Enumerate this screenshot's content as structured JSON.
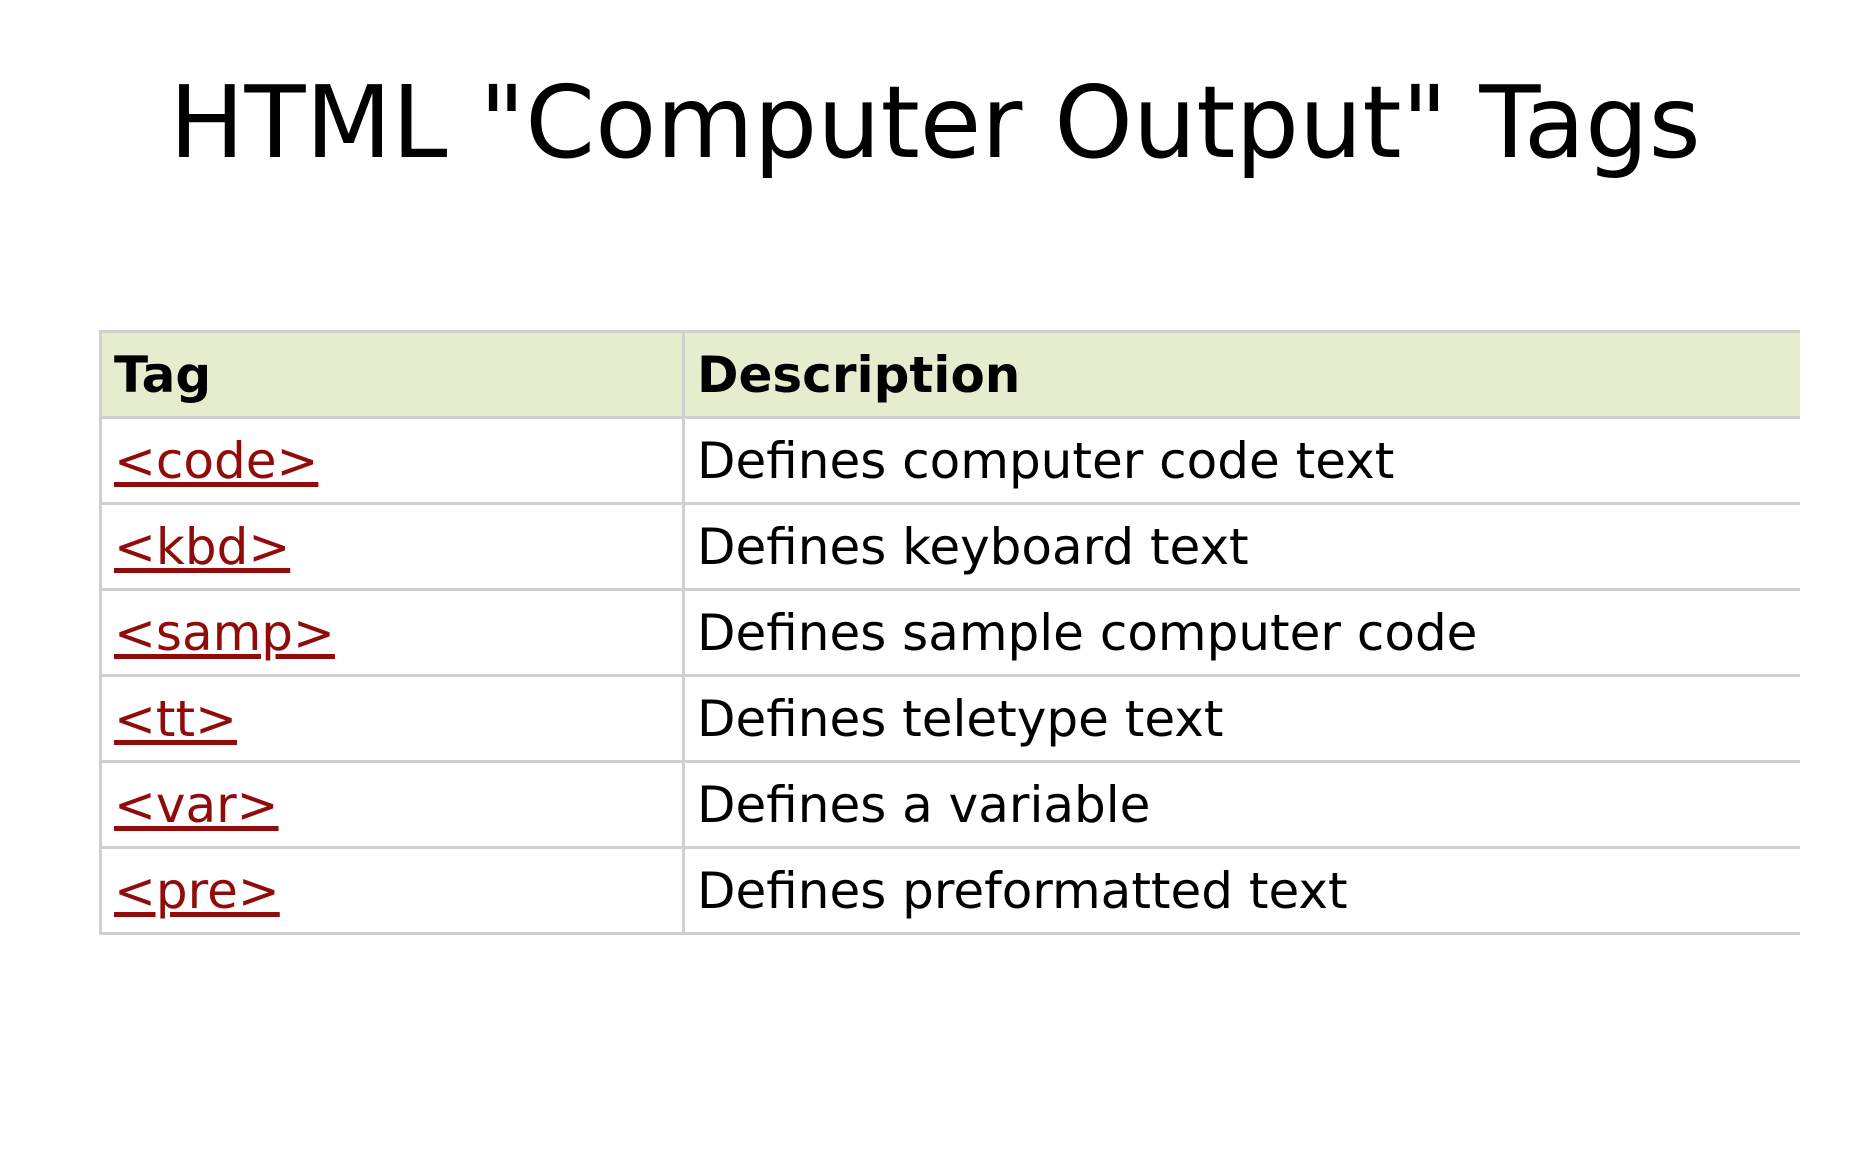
{
  "slide": {
    "title": "HTML \"Computer Output\" Tags"
  },
  "table": {
    "headers": {
      "tag": "Tag",
      "description": "Description"
    },
    "rows": [
      {
        "tag": "<code>",
        "description": "Defines computer code text"
      },
      {
        "tag": "<kbd>",
        "description": "Defines keyboard text"
      },
      {
        "tag": "<samp>",
        "description": "Defines sample computer code"
      },
      {
        "tag": "<tt>",
        "description": "Defines teletype text"
      },
      {
        "tag": "<var>",
        "description": "Defines a variable"
      },
      {
        "tag": "<pre>",
        "description": "Defines preformatted text"
      }
    ]
  },
  "colors": {
    "header_background": "#e6edcf",
    "link": "#900b09",
    "border": "#d0d0d0"
  }
}
